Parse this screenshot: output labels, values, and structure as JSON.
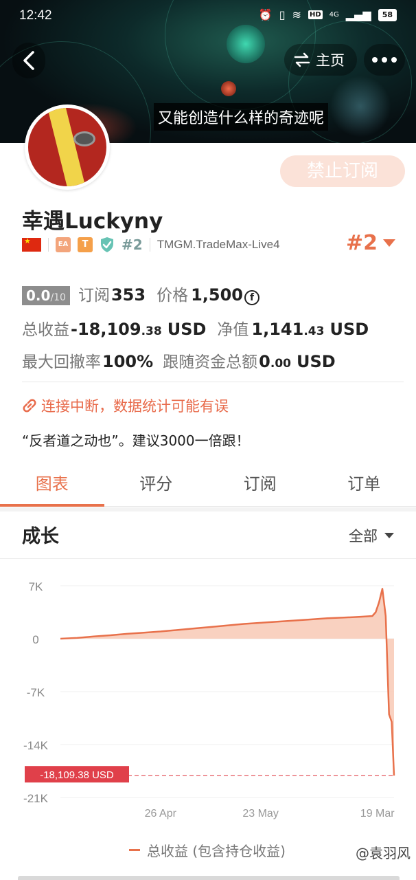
{
  "status_bar": {
    "time": "12:42",
    "hd_label": "HD",
    "network": "4G",
    "battery": "58"
  },
  "header": {
    "home_label": "主页",
    "video_subtitle": "又能创造什么样的奇迹呢"
  },
  "profile": {
    "unsubscribe_label": "禁止订阅",
    "name": "幸遇Luckyny",
    "badge_ea": "EA",
    "badge_t": "T",
    "rank_small": "#2",
    "broker": "TMGM.TradeMax-Live4",
    "rank_big": "#2"
  },
  "stats": {
    "score": "0.0",
    "score_max": "/10",
    "subscribe_label": "订阅",
    "subscribe_count": "353",
    "price_label": "价格",
    "price_value": "1,500",
    "price_coin": "f",
    "total_profit_label": "总收益",
    "total_profit_main": "-18,109",
    "total_profit_dec": ".38",
    "total_profit_unit": "USD",
    "equity_label": "净值",
    "equity_main": "1,141",
    "equity_dec": ".43",
    "equity_unit": "USD",
    "drawdown_label": "最大回撤率",
    "drawdown_value": "100%",
    "follow_fund_label": "跟随资金总额",
    "follow_fund_main": "0",
    "follow_fund_dec": ".00",
    "follow_fund_unit": "USD"
  },
  "notice": {
    "warning": "连接中断，数据统计可能有误",
    "bio": "“反者道之动也”。建议3000一倍跟！"
  },
  "tabs": [
    {
      "label": "图表",
      "active": true
    },
    {
      "label": "评分",
      "active": false
    },
    {
      "label": "订阅",
      "active": false
    },
    {
      "label": "订单",
      "active": false
    }
  ],
  "growth": {
    "title": "成长",
    "filter": "全部",
    "legend": "总收益 (包含持仓收益)"
  },
  "watermark": "@袁羽风",
  "colors": {
    "accent": "#e8714b",
    "area_fill": "#f8c9b5",
    "negative_label": "#e0404a"
  },
  "chart_data": {
    "type": "area",
    "ylabel": "",
    "xlabel": "",
    "ylim": [
      -21000,
      7000
    ],
    "y_ticks": [
      7000,
      0,
      -7000,
      -14000,
      -21000
    ],
    "y_tick_labels": [
      "7K",
      "0",
      "-7K",
      "-14K",
      "-21K"
    ],
    "x_tick_labels": [
      "26 Apr",
      "23 May",
      "19 Mar"
    ],
    "x_tick_index": [
      0.3,
      0.6,
      0.95
    ],
    "final_value_label": "-18,109.38 USD",
    "final_value": -18109.38,
    "series": [
      {
        "name": "总收益 (包含持仓收益)",
        "x": [
          0.0,
          0.05,
          0.1,
          0.15,
          0.2,
          0.25,
          0.3,
          0.35,
          0.4,
          0.45,
          0.5,
          0.55,
          0.6,
          0.65,
          0.7,
          0.75,
          0.8,
          0.85,
          0.88,
          0.9,
          0.92,
          0.935,
          0.945,
          0.955,
          0.965,
          0.975,
          0.985,
          0.993,
          1.0
        ],
        "values": [
          0,
          100,
          300,
          450,
          650,
          800,
          950,
          1150,
          1350,
          1550,
          1750,
          1950,
          2100,
          2250,
          2400,
          2550,
          2700,
          2800,
          2850,
          2900,
          2950,
          3000,
          3500,
          4800,
          6600,
          3000,
          -10000,
          -11000,
          -18109.38
        ]
      }
    ]
  }
}
